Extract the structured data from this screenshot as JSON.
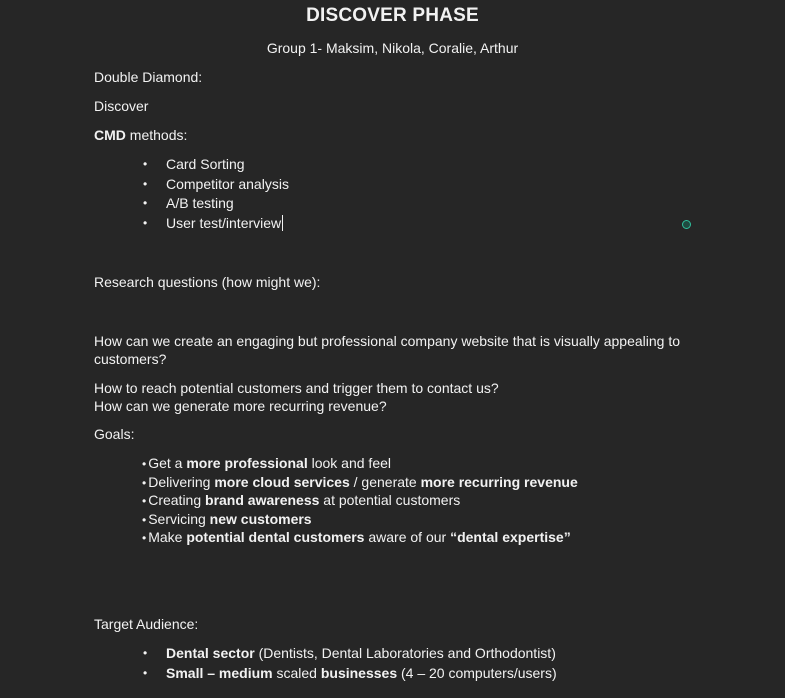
{
  "doc": {
    "title": "DISCOVER PHASE",
    "subtitle": "Group 1- Maksim, Nikola, Coralie, Arthur",
    "double_diamond_label": "Double Diamond:",
    "discover_label": "Discover",
    "cmd_bold": "CMD",
    "cmd_rest": " methods:",
    "bullet_glyph": "•",
    "methods": [
      "Card Sorting",
      "Competitor analysis",
      "A/B testing",
      "User test/interview"
    ],
    "research_label": "Research questions (how might we):",
    "question_1": "How can we create an engaging but professional company website that is visually appealing to customers?",
    "question_2": "How to reach potential customers and trigger them to contact us?",
    "question_3": "How can we generate more recurring revenue?",
    "goals_label": "Goals:",
    "goals": {
      "g1": {
        "a": "Get a ",
        "b": "more professional",
        "c": " look and feel"
      },
      "g2": {
        "a": "Delivering ",
        "b": "more cloud services",
        "c": " / generate ",
        "d": "more recurring revenue"
      },
      "g3": {
        "a": "Creating ",
        "b": "brand awareness",
        "c": " at potential customers"
      },
      "g4": {
        "a": "Servicing ",
        "b": "new customers"
      },
      "g5": {
        "a": "Make ",
        "b": "potential dental customers",
        "c": " aware of our ",
        "d": "“dental expertise”"
      }
    },
    "target_label": "Target Audience:",
    "audience": {
      "a1": {
        "bold": "Dental sector",
        "rest": " (Dentists, Dental Laboratories and Orthodontist)"
      },
      "a2": {
        "bold1": "Small – medium",
        "mid": " scaled ",
        "bold2": "businesses",
        "rest": " (4 – 20 computers/users)"
      }
    }
  },
  "colors": {
    "background": "#262626",
    "text": "#f2f2f2",
    "marker": "#2fbf9c"
  }
}
